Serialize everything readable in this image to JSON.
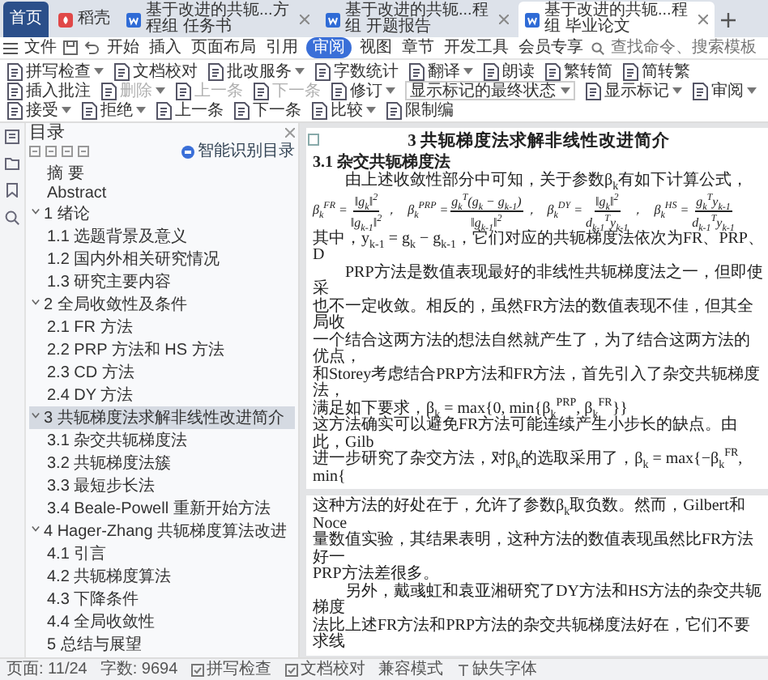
{
  "tabs": [
    {
      "label": "首页",
      "kind": "home",
      "selected": false
    },
    {
      "label": "稻壳",
      "kind": "docer",
      "selected": false
    },
    {
      "label": "基于改进的共轭...方程组 任务书",
      "kind": "doc",
      "selected": false
    },
    {
      "label": "基于改进的共轭...程组 开题报告",
      "kind": "doc",
      "selected": false
    },
    {
      "label": "基于改进的共轭...程组 毕业论文",
      "kind": "doc",
      "selected": true
    }
  ],
  "menu": {
    "file": "文件",
    "items": [
      {
        "label": "开始",
        "selected": false
      },
      {
        "label": "插入",
        "selected": false
      },
      {
        "label": "页面布局",
        "selected": false
      },
      {
        "label": "引用",
        "selected": false
      },
      {
        "label": "审阅",
        "selected": true
      },
      {
        "label": "视图",
        "selected": false
      },
      {
        "label": "章节",
        "selected": false
      },
      {
        "label": "开发工具",
        "selected": false
      },
      {
        "label": "会员专享",
        "selected": false
      }
    ],
    "search": {
      "placeholder": "查找命令、搜索模板"
    }
  },
  "toolbar": [
    {
      "kind": "button",
      "label": "拼写检查",
      "dropdown": true,
      "disabled": false
    },
    {
      "kind": "button",
      "label": "文档校对",
      "dropdown": false,
      "disabled": false
    },
    {
      "kind": "button",
      "label": "批改服务",
      "dropdown": true,
      "disabled": false
    },
    {
      "kind": "button",
      "label": "字数统计",
      "dropdown": false,
      "disabled": false
    },
    {
      "kind": "button",
      "label": "翻译",
      "dropdown": true,
      "disabled": false
    },
    {
      "kind": "button",
      "label": "朗读",
      "dropdown": false,
      "disabled": false
    },
    {
      "kind": "button",
      "label": "繁转简",
      "dropdown": false,
      "disabled": false
    },
    {
      "kind": "button",
      "label": "简转繁",
      "dropdown": false,
      "disabled": false
    },
    {
      "kind": "button",
      "label": "插入批注",
      "dropdown": false,
      "disabled": false
    },
    {
      "kind": "button",
      "label": "删除",
      "dropdown": true,
      "disabled": true
    },
    {
      "kind": "button",
      "label": "上一条",
      "dropdown": false,
      "disabled": true
    },
    {
      "kind": "button",
      "label": "下一条",
      "dropdown": false,
      "disabled": true
    },
    {
      "kind": "button",
      "label": "修订",
      "dropdown": true,
      "disabled": false
    },
    {
      "kind": "select",
      "label": "显示标记的最终状态",
      "dropdown": true,
      "disabled": false
    },
    {
      "kind": "button",
      "label": "显示标记",
      "dropdown": true,
      "disabled": false
    },
    {
      "kind": "button",
      "label": "审阅",
      "dropdown": true,
      "disabled": false
    },
    {
      "kind": "button",
      "label": "接受",
      "dropdown": true,
      "disabled": false
    },
    {
      "kind": "button",
      "label": "拒绝",
      "dropdown": true,
      "disabled": false
    },
    {
      "kind": "button",
      "label": "上一条",
      "dropdown": false,
      "disabled": false
    },
    {
      "kind": "button",
      "label": "下一条",
      "dropdown": false,
      "disabled": false
    },
    {
      "kind": "button",
      "label": "比较",
      "dropdown": true,
      "disabled": false
    },
    {
      "kind": "button",
      "label": "限制编",
      "dropdown": false,
      "disabled": false
    }
  ],
  "toc": {
    "title": "目录",
    "smart": "智能识别目录",
    "items": [
      {
        "label": "摘 要",
        "selected": false
      },
      {
        "label": "Abstract",
        "selected": false
      },
      {
        "label": "1 绪论",
        "selected": false,
        "expanded": true,
        "children": [
          {
            "label": "1.1 选题背景及意义",
            "selected": false
          },
          {
            "label": "1.2 国内外相关研究情况",
            "selected": false
          },
          {
            "label": "1.3 研究主要内容",
            "selected": false
          }
        ]
      },
      {
        "label": "2 全局收敛性及条件",
        "selected": false,
        "expanded": true,
        "children": [
          {
            "label": "2.1 FR 方法",
            "selected": false
          },
          {
            "label": "2.2 PRP 方法和 HS 方法",
            "selected": false
          },
          {
            "label": "2.3 CD 方法",
            "selected": false
          },
          {
            "label": "2.4 DY 方法",
            "selected": false
          }
        ]
      },
      {
        "label": "3 共轭梯度法求解非线性改进简介",
        "selected": true,
        "expanded": true,
        "children": [
          {
            "label": "3.1 杂交共轭梯度法",
            "selected": false
          },
          {
            "label": "3.2 共轭梯度法簇",
            "selected": false
          },
          {
            "label": "3.3 最短步长法",
            "selected": false
          },
          {
            "label": "3.4 Beale-Powell 重新开始方法",
            "selected": false
          }
        ]
      },
      {
        "label": "4 Hager-Zhang 共轭梯度算法改进",
        "selected": false,
        "expanded": true,
        "children": [
          {
            "label": "4.1 引言",
            "selected": false
          },
          {
            "label": "4.2 共轭梯度算法",
            "selected": false
          },
          {
            "label": "4.3 下降条件",
            "selected": false
          },
          {
            "label": "4.4 全局收敛性",
            "selected": false
          }
        ]
      },
      {
        "label": "5 总结与展望",
        "selected": false
      }
    ]
  },
  "document": {
    "pages": [
      {
        "blocks": [
          {
            "kind": "chapter",
            "text": "3 共轭梯度法求解非线性改进简介"
          },
          {
            "kind": "section",
            "text": "3.1 杂交共轭梯度法"
          },
          {
            "kind": "line",
            "indent": true,
            "text": "由上述收敛性部分中可知，关于参数β$_{k}$有如下计算公式，"
          },
          {
            "kind": "formulas",
            "items": [
              {
                "lhs": "β$_{k}$$^{FR}$ =",
                "num": "‖g$_{k}$‖$^{2}$",
                "den": "‖g$_{k-1}$‖$^{2}$",
                "tail": "，"
              },
              {
                "lhs": "β$_{k}$$^{PRP}$ =",
                "num": "g$_{k}$$^{T}$(g$_{k}$ − g$_{k-1}$)",
                "den": "‖g$_{k-1}$‖$^{2}$",
                "tail": "，"
              },
              {
                "lhs": "β$_{k}$$^{DY}$ =",
                "num": "‖g$_{k}$‖$^{2}$",
                "den": "d$_{k-1}$$^{T}$y$_{k-1}$",
                "tail": "，"
              },
              {
                "lhs": "β$_{k}$$^{HS}$ =",
                "num": "g$_{k}$$^{T}$y$_{k-1}$",
                "den": "d$_{k-1}$$^{T}$y$_{k-1}$"
              }
            ]
          },
          {
            "kind": "line",
            "indent": false,
            "text": "其中，y$_{k-1}$ = g$_{k}$ − g$_{k-1}$，它们对应的共轭梯度法依次为FR、PRP、D"
          },
          {
            "kind": "line",
            "indent": true,
            "text": "PRP方法是数值表现最好的非线性共轭梯度法之一，但即使采"
          },
          {
            "kind": "line",
            "indent": false,
            "text": "也不一定收敛。相反的，虽然FR方法的数值表现不佳，但其全局收"
          },
          {
            "kind": "line",
            "indent": false,
            "text": "一个结合这两方法的想法自然就产生了，为了结合这两方法的优点，"
          },
          {
            "kind": "line",
            "indent": false,
            "text": "和Storey考虑结合PRP方法和FR方法，首先引入了杂交共轭梯度法，"
          },
          {
            "kind": "line",
            "indent": false,
            "text": "满足如下要求，β$_{k}$ = max{0, min{β$_{k}$$^{PRP}$, β$_{k}$$^{FR}$}}"
          },
          {
            "kind": "line",
            "indent": false,
            "text": "这方法确实可以避免FR方法可能连续产生小步长的缺点。由此，Gilb"
          },
          {
            "kind": "line",
            "indent": false,
            "text": "进一步研究了杂交方法，对β$_{k}$的选取采用了，β$_{k}$ = max{−β$_{k}$$^{FR}$, min{"
          }
        ]
      },
      {
        "blocks": [
          {
            "kind": "line",
            "indent": false,
            "text": "这种方法的好处在于，允许了参数β$_{k}$取负数。然而，Gilbert和Noce"
          },
          {
            "kind": "line",
            "indent": false,
            "text": "量数值实验，其结果表明，这种方法的数值表现虽然比FR方法好一"
          },
          {
            "kind": "line",
            "indent": false,
            "text": "PRP方法差很多。"
          },
          {
            "kind": "line",
            "indent": true,
            "text": "另外，戴彧虹和袁亚湘研究了DY方法和HS方法的杂交共轭梯度"
          },
          {
            "kind": "line",
            "indent": false,
            "text": "法比上述FR方法和PRP方法的杂交共轭梯度法好在，它们不要求线"
          }
        ]
      }
    ]
  },
  "status_bar": [
    {
      "kind": "text",
      "text": "页面: 11/24"
    },
    {
      "kind": "text",
      "text": "字数: 9694"
    },
    {
      "kind": "check",
      "text": "拼写检查"
    },
    {
      "kind": "check",
      "text": "文档校对"
    },
    {
      "kind": "text",
      "text": "兼容模式"
    },
    {
      "kind": "font",
      "text": "缺失字体"
    }
  ]
}
